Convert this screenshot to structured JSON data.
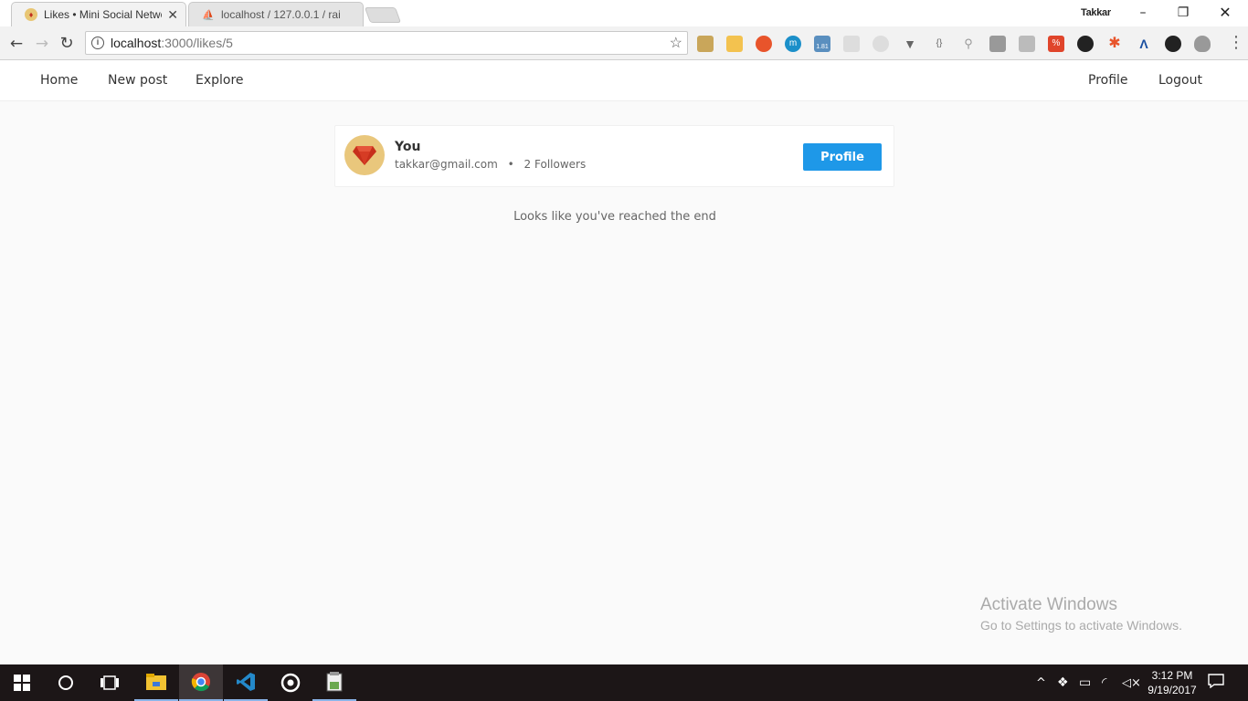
{
  "browser": {
    "tabs": [
      {
        "title": "Likes • Mini Social Netwo",
        "favicon": "ruby-icon"
      },
      {
        "title": "localhost / 127.0.0.1 / rai",
        "favicon": "phpmyadmin-icon"
      }
    ],
    "user": "Takkar",
    "url_host": "localhost",
    "url_path": ":3000/likes/5"
  },
  "extensions": {
    "badge": "1.81"
  },
  "nav": {
    "home": "Home",
    "new_post": "New post",
    "explore": "Explore",
    "profile": "Profile",
    "logout": "Logout"
  },
  "user_card": {
    "name": "You",
    "email": "takkar@gmail.com",
    "separator": "•",
    "followers": "2 Followers",
    "button": "Profile"
  },
  "end_message": "Looks like you've reached the end",
  "watermark": {
    "line1": "Activate Windows",
    "line2": "Go to Settings to activate Windows."
  },
  "taskbar": {
    "time": "3:12 PM",
    "date": "9/19/2017"
  },
  "colors": {
    "accent": "#1e98e8",
    "avatar_bg": "#e9c77c",
    "ruby": "#d23a24"
  }
}
